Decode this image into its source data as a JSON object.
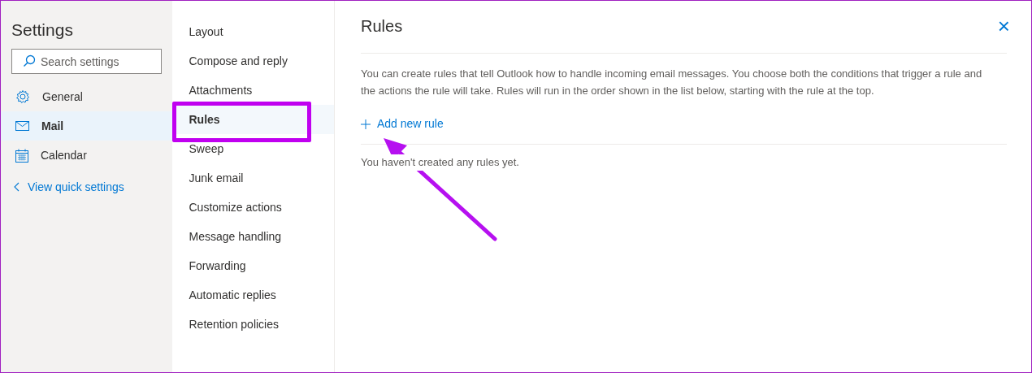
{
  "settings": {
    "title": "Settings",
    "search": {
      "placeholder": "Search settings"
    },
    "categories": [
      {
        "kind": "gear",
        "label": "General",
        "selected": false
      },
      {
        "kind": "mail",
        "label": "Mail",
        "selected": true
      },
      {
        "kind": "calendar",
        "label": "Calendar",
        "selected": false
      }
    ],
    "quick_settings_link": "View quick settings"
  },
  "subsections": [
    {
      "label": "Layout",
      "selected": false
    },
    {
      "label": "Compose and reply",
      "selected": false
    },
    {
      "label": "Attachments",
      "selected": false
    },
    {
      "label": "Rules",
      "selected": true
    },
    {
      "label": "Sweep",
      "selected": false
    },
    {
      "label": "Junk email",
      "selected": false
    },
    {
      "label": "Customize actions",
      "selected": false
    },
    {
      "label": "Message handling",
      "selected": false
    },
    {
      "label": "Forwarding",
      "selected": false
    },
    {
      "label": "Automatic replies",
      "selected": false
    },
    {
      "label": "Retention policies",
      "selected": false
    }
  ],
  "panel": {
    "title": "Rules",
    "close": "×",
    "description": "You can create rules that tell Outlook how to handle incoming email messages. You choose both the conditions that trigger a rule and the actions the rule will take. Rules will run in the order shown in the list below, starting with the rule at the top.",
    "add_rule": "Add new rule",
    "empty_message": "You haven't created any rules yet."
  }
}
